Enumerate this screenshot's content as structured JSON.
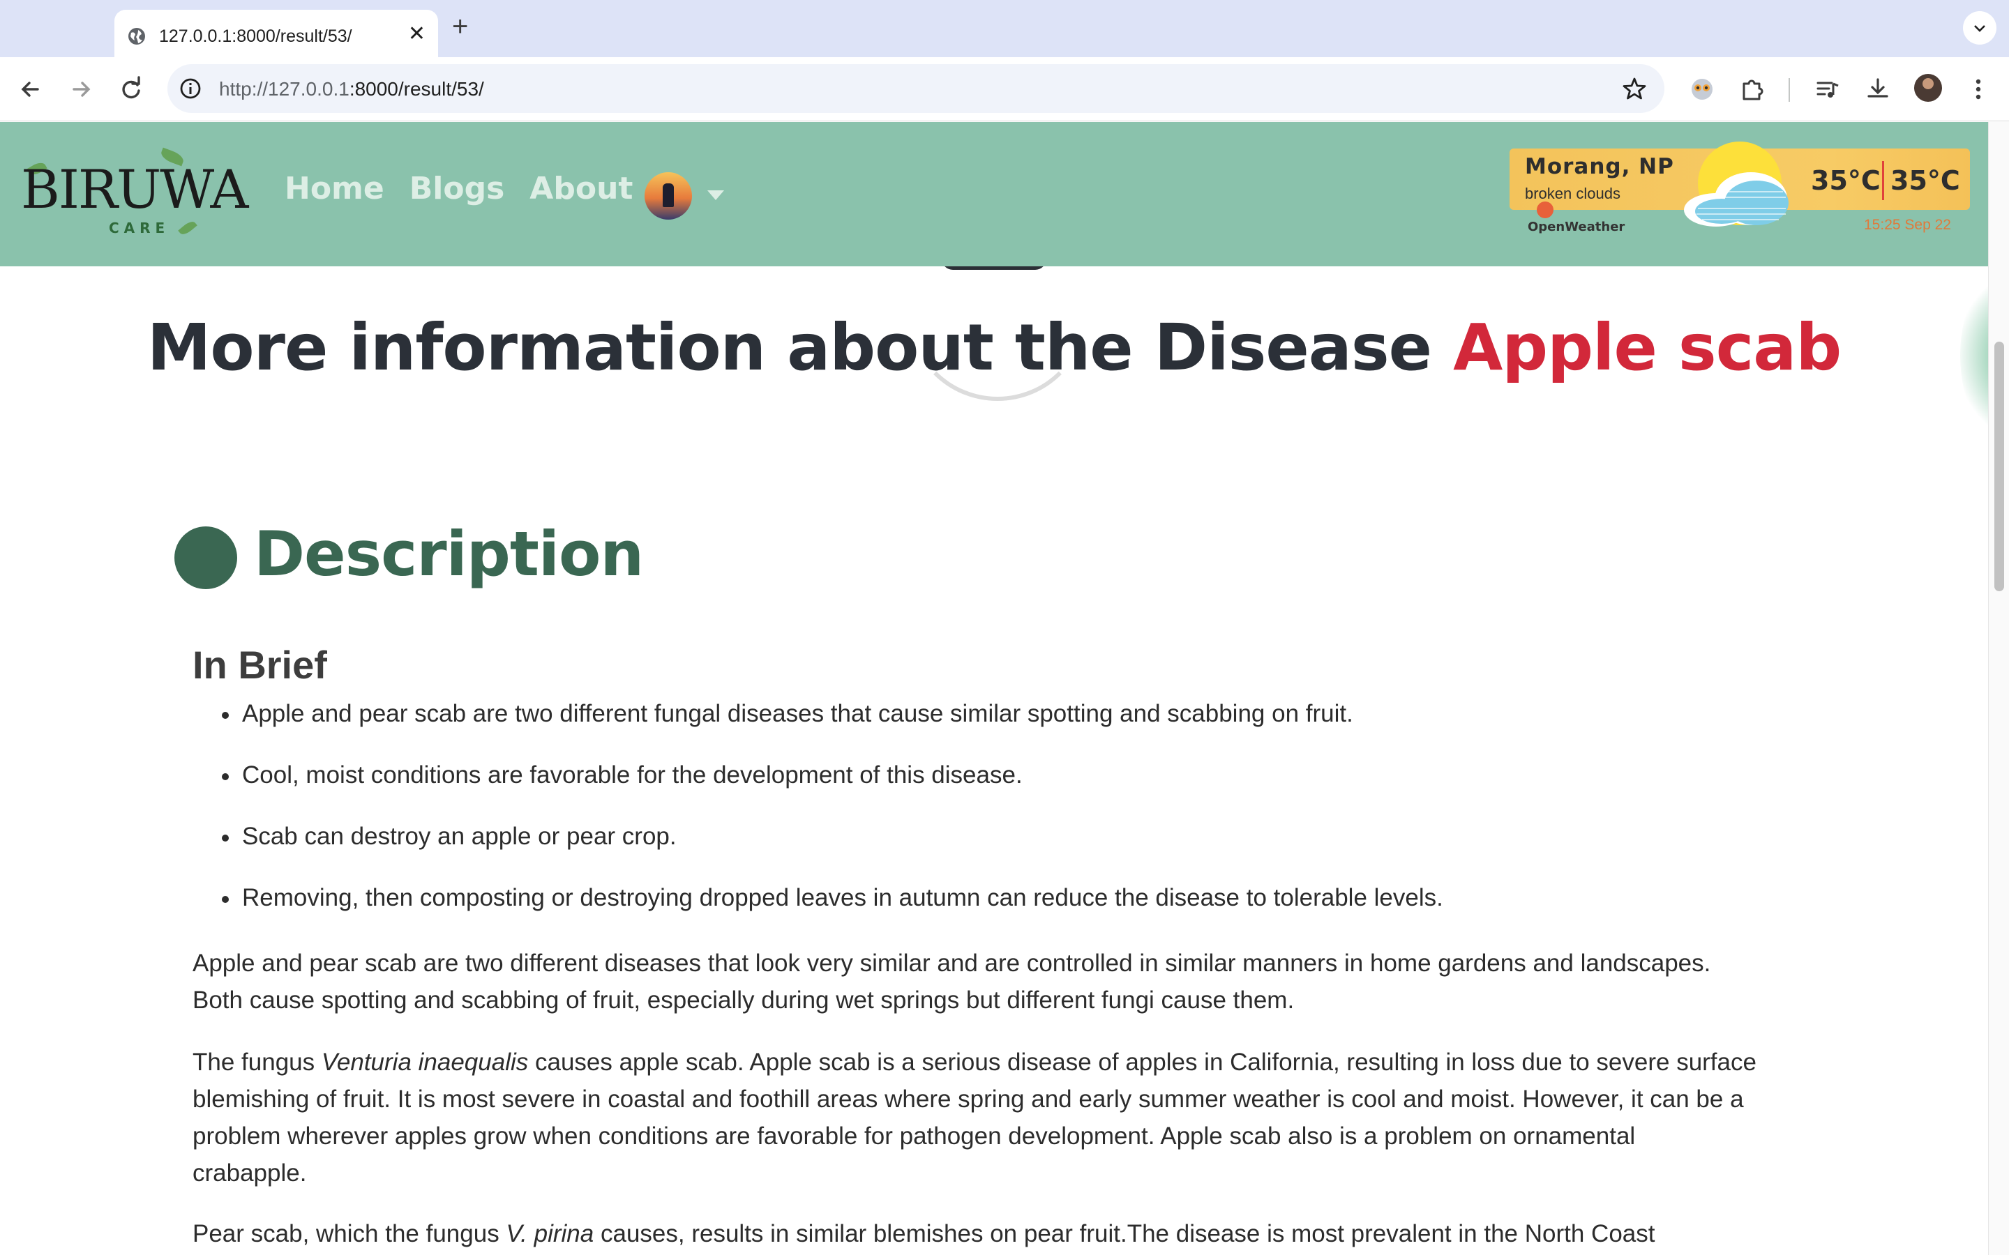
{
  "browser": {
    "tab_title": "127.0.0.1:8000/result/53/",
    "url_host": "http://127.0.0.1",
    "url_rest": ":8000/result/53/"
  },
  "site": {
    "logo_text": "BIRUWA",
    "logo_sub": "CARE",
    "nav": {
      "home": "Home",
      "blogs": "Blogs",
      "about": "About"
    }
  },
  "weather": {
    "city": "Morang, NP",
    "description": "broken clouds",
    "temp_main": "35°C",
    "temp_feels": "35°C",
    "provider": "OpenWeather",
    "time": "15:25 Sep 22"
  },
  "page": {
    "heading_prefix": "More information about the Disease ",
    "disease_name": "Apple scab",
    "section_title": "Description",
    "subsection_title": "In Brief",
    "bullets": [
      "Apple and pear scab are two different fungal diseases that cause similar spotting and scabbing on fruit.",
      "Cool, moist conditions are favorable for the development of this disease.",
      "Scab can destroy an apple or pear crop.",
      "Removing, then composting or destroying dropped leaves in autumn can reduce the disease to tolerable levels."
    ],
    "para1": {
      "line1": "Apple and pear scab are two different diseases that look very similar and are controlled in similar manners in home gardens and landscapes.",
      "line2": "Both cause spotting and scabbing of fruit, especially during wet springs but different fungi cause them."
    },
    "para2": {
      "pre": "The fungus ",
      "species": "Venturia inaequalis",
      "post": " causes apple scab. Apple scab is a serious disease of apples in California, resulting in loss due to severe surface",
      "line2": "blemishing of fruit. It is most severe in coastal and foothill areas where spring and early summer weather is cool and moist. However, it can be a",
      "line3": "problem wherever apples grow when conditions are favorable for pathogen development. Apple scab also is a problem on ornamental",
      "line4": "crabapple."
    },
    "para3": {
      "pre": "Pear scab, which the fungus ",
      "species": "V. pirina",
      "post": " causes, results in similar blemishes on pear fruit.The disease is most prevalent in the North Coast"
    }
  }
}
